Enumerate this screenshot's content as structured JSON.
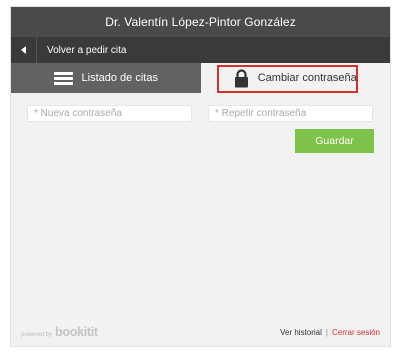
{
  "header": {
    "title": "Dr. Valentín López-Pintor González"
  },
  "nav": {
    "back_label": "Volver a pedir cita"
  },
  "tabs": [
    {
      "label": "Listado de citas",
      "icon": "menu-icon"
    },
    {
      "label": "Cambiar contraseña",
      "icon": "lock-icon"
    }
  ],
  "form": {
    "new_password_placeholder": "* Nueva contraseña",
    "repeat_password_placeholder": "* Repetir contraseña",
    "save_label": "Guardar"
  },
  "footer": {
    "powered_by": "powered by",
    "brand": "bookitit",
    "history_link": "Ver historial",
    "separator": "|",
    "logout_link": "Cerrar sesión"
  },
  "colors": {
    "accent_green": "#7fc24a",
    "highlight_red": "#d0312d",
    "header_dark": "#4a4a4a"
  }
}
